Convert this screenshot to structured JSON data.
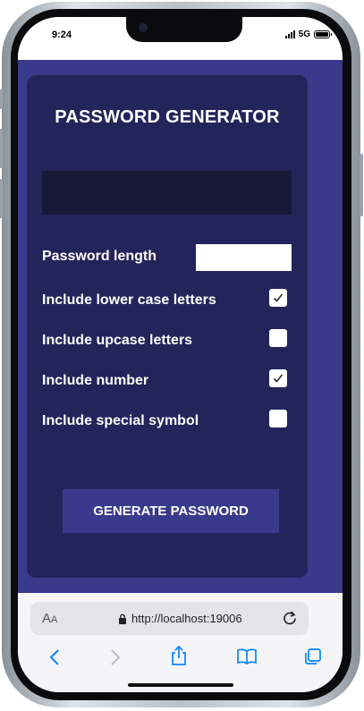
{
  "status_bar": {
    "time": "9:24",
    "network": "5G"
  },
  "app": {
    "title": "PASSWORD GENERATOR",
    "generated_password": "",
    "options": [
      {
        "label": "Password length",
        "type": "number",
        "value": ""
      },
      {
        "label": "Include lower case letters",
        "type": "checkbox",
        "checked": true
      },
      {
        "label": "Include upcase letters",
        "type": "checkbox",
        "checked": false
      },
      {
        "label": "Include number",
        "type": "checkbox",
        "checked": true
      },
      {
        "label": "Include special symbol",
        "type": "checkbox",
        "checked": false
      }
    ],
    "generate_label": "GENERATE PASSWORD"
  },
  "browser": {
    "text_size_label": "AA",
    "url": "http://localhost:19006",
    "icons": [
      "text-size-icon",
      "lock-icon",
      "reload-icon",
      "back-icon",
      "forward-icon",
      "share-icon",
      "bookmarks-icon",
      "tabs-icon"
    ]
  },
  "colors": {
    "page_bg": "#3a3a8c",
    "card_bg": "#23245a",
    "result_bg": "#181938",
    "button_bg": "#3a3a8c",
    "accent": "#0a84ff"
  }
}
